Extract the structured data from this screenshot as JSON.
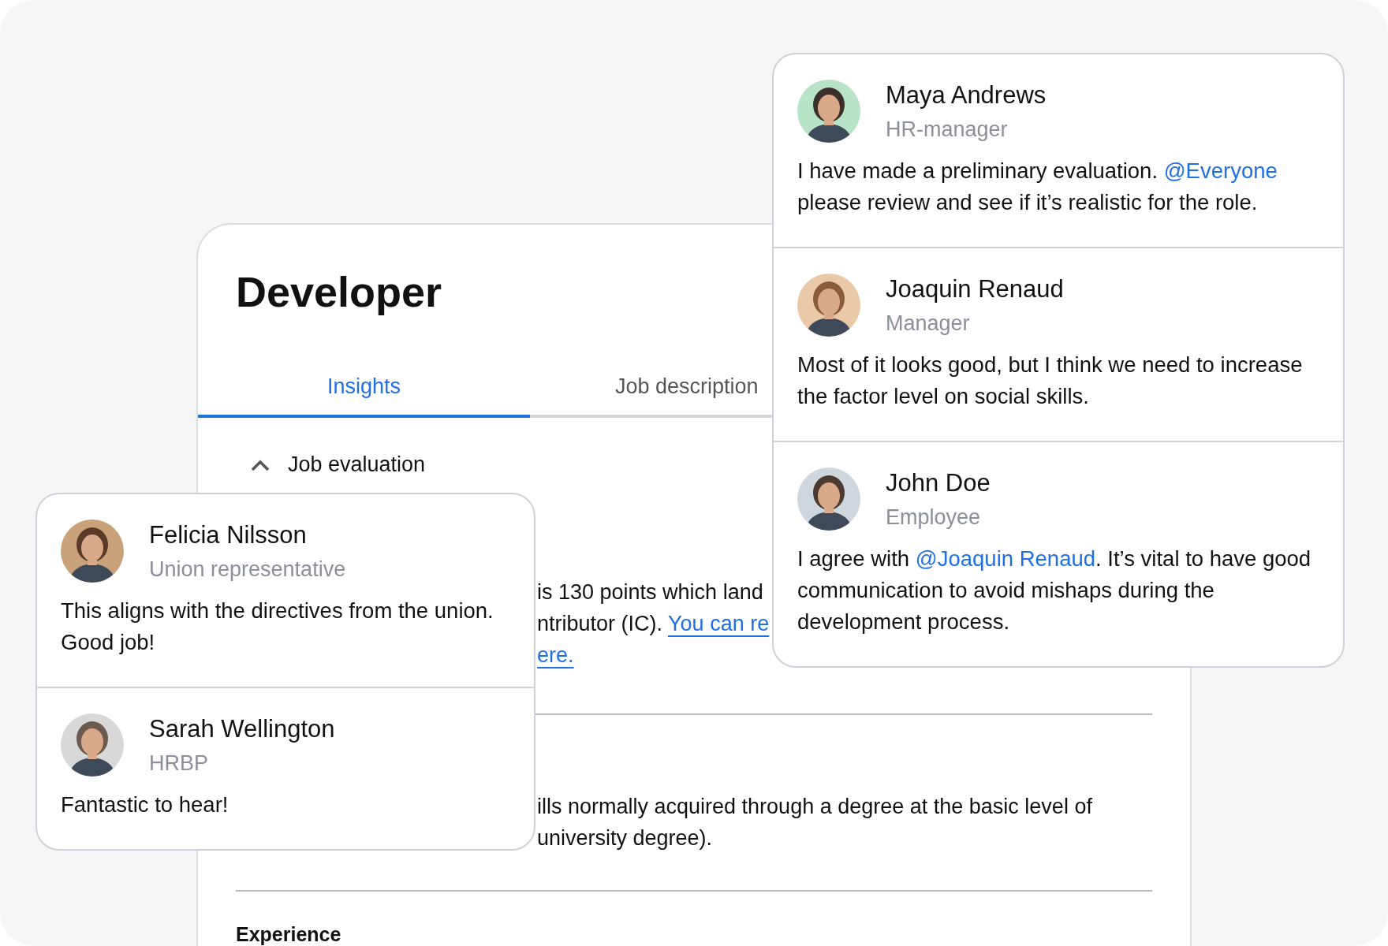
{
  "job": {
    "title": "Developer",
    "tabs": [
      {
        "label": "Insights",
        "selected": true
      },
      {
        "label": "Job description",
        "selected": false
      }
    ],
    "section": {
      "title": "Job evaluation",
      "expanded": true
    },
    "paragraph_1": [
      [
        {
          "kind": "text",
          "text": "is 130 points which land"
        }
      ],
      [
        {
          "kind": "text",
          "text": "ntributor (IC). "
        },
        {
          "kind": "link",
          "text": "You can re"
        }
      ],
      [
        {
          "kind": "link",
          "text": "ere."
        }
      ]
    ],
    "paragraph_2": [
      [
        {
          "kind": "text",
          "text": "ills normally acquired through a degree at the basic level of"
        }
      ],
      [
        {
          "kind": "text",
          "text": "university degree)."
        }
      ]
    ],
    "next_section": "Experience"
  },
  "comments_left": [
    {
      "name": "Felicia Nilsson",
      "role": "Union representative",
      "body": [
        {
          "kind": "text",
          "text": "This aligns with the directives from the union. Good job!"
        }
      ]
    },
    {
      "name": "Sarah Wellington",
      "role": "HRBP",
      "body": [
        {
          "kind": "text",
          "text": "Fantastic to hear!"
        }
      ]
    }
  ],
  "comments_right": [
    {
      "name": "Maya Andrews",
      "role": "HR-manager",
      "body": [
        {
          "kind": "text",
          "text": "I have made a preliminary evaluation. "
        },
        {
          "kind": "mention",
          "text": "@Everyone"
        },
        {
          "kind": "text",
          "text": " please review and see if it’s realistic for the role."
        }
      ]
    },
    {
      "name": "Joaquin Renaud",
      "role": "Manager",
      "body": [
        {
          "kind": "text",
          "text": "Most of it looks good, but I think we need to increase the factor level on social skills."
        }
      ]
    },
    {
      "name": "John Doe",
      "role": "Employee",
      "body": [
        {
          "kind": "text",
          "text": "I agree with "
        },
        {
          "kind": "mention",
          "text": "@Joaquin Renaud"
        },
        {
          "kind": "text",
          "text": ". It’s vital to have good communication to avoid mishaps during the development process."
        }
      ]
    }
  ]
}
